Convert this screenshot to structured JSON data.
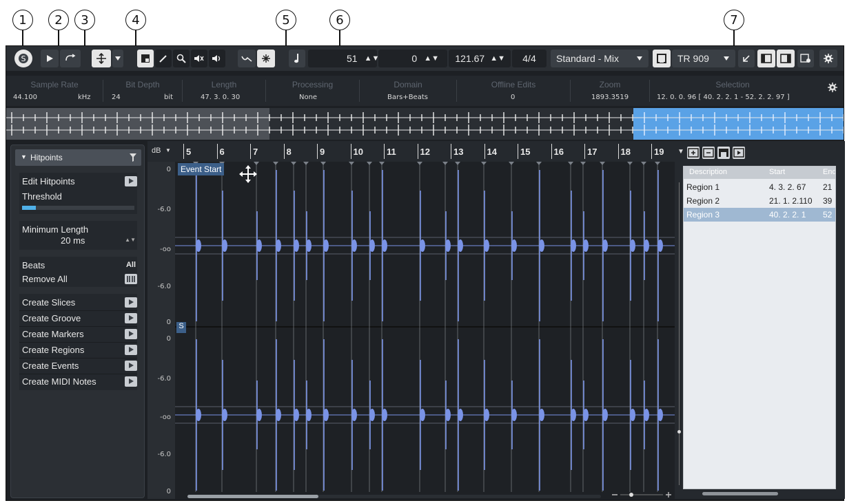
{
  "callouts": [
    "1",
    "2",
    "3",
    "4",
    "5",
    "6",
    "7"
  ],
  "toolbar": {
    "position_value": "51",
    "offset_value": "0",
    "tempo_value": "121.67",
    "signature_value": "4/4",
    "mix_preset": "Standard - Mix",
    "drum_kit": "TR 909"
  },
  "infoline": {
    "labels": [
      "Sample Rate",
      "Bit Depth",
      "Length",
      "Processing",
      "Domain",
      "Offline Edits",
      "Zoom",
      "Selection"
    ],
    "values": {
      "sample_rate": "44.100",
      "sample_rate_unit": "kHz",
      "bit_depth": "24",
      "bit_depth_unit": "bit",
      "length": "47. 3. 0. 30",
      "processing": "None",
      "domain": "Bars+Beats",
      "offline_edits": "0",
      "zoom": "1893.3519",
      "selection": "12. 0. 0. 96 [ 40. 2. 2. 1 - 52. 2. 2. 97 ]"
    }
  },
  "inspector": {
    "section_title": "Hitpoints",
    "edit_hitpoints": "Edit Hitpoints",
    "threshold": "Threshold",
    "threshold_level": 0.12,
    "minimum_length_label": "Minimum Length",
    "minimum_length_value": "20 ms",
    "beats_label": "Beats",
    "beats_value": "All",
    "remove_all": "Remove All",
    "actions": [
      "Create Slices",
      "Create Groove",
      "Create Markers",
      "Create Regions",
      "Create Events",
      "Create MIDI Notes"
    ]
  },
  "editor": {
    "db_unit": "dB",
    "ruler_ticks": [
      "5",
      "6",
      "7",
      "8",
      "9",
      "10",
      "11",
      "12",
      "13",
      "14",
      "15",
      "16",
      "17",
      "18",
      "19"
    ],
    "event_start_label": "Event Start",
    "snap_marker": "S",
    "db_labels_top": [
      "0",
      "-6.0",
      "-oo",
      "-6.0",
      "0"
    ],
    "db_labels_bottom": [
      "0",
      "-6.0",
      "-oo",
      "-6.0",
      "0"
    ],
    "waveform_color": "#7a93e6"
  },
  "regions": {
    "columns": [
      "Description",
      "Start",
      "End"
    ],
    "rows": [
      {
        "description": "Region 1",
        "start": "4. 3. 2. 67",
        "end": "21"
      },
      {
        "description": "Region 2",
        "start": "21. 1. 2.110",
        "end": "39"
      },
      {
        "description": "Region 3",
        "start": "40. 2. 2. 1",
        "end": "52"
      }
    ],
    "selected_row_index": 2,
    "selection_color": "#9fb8d2"
  }
}
